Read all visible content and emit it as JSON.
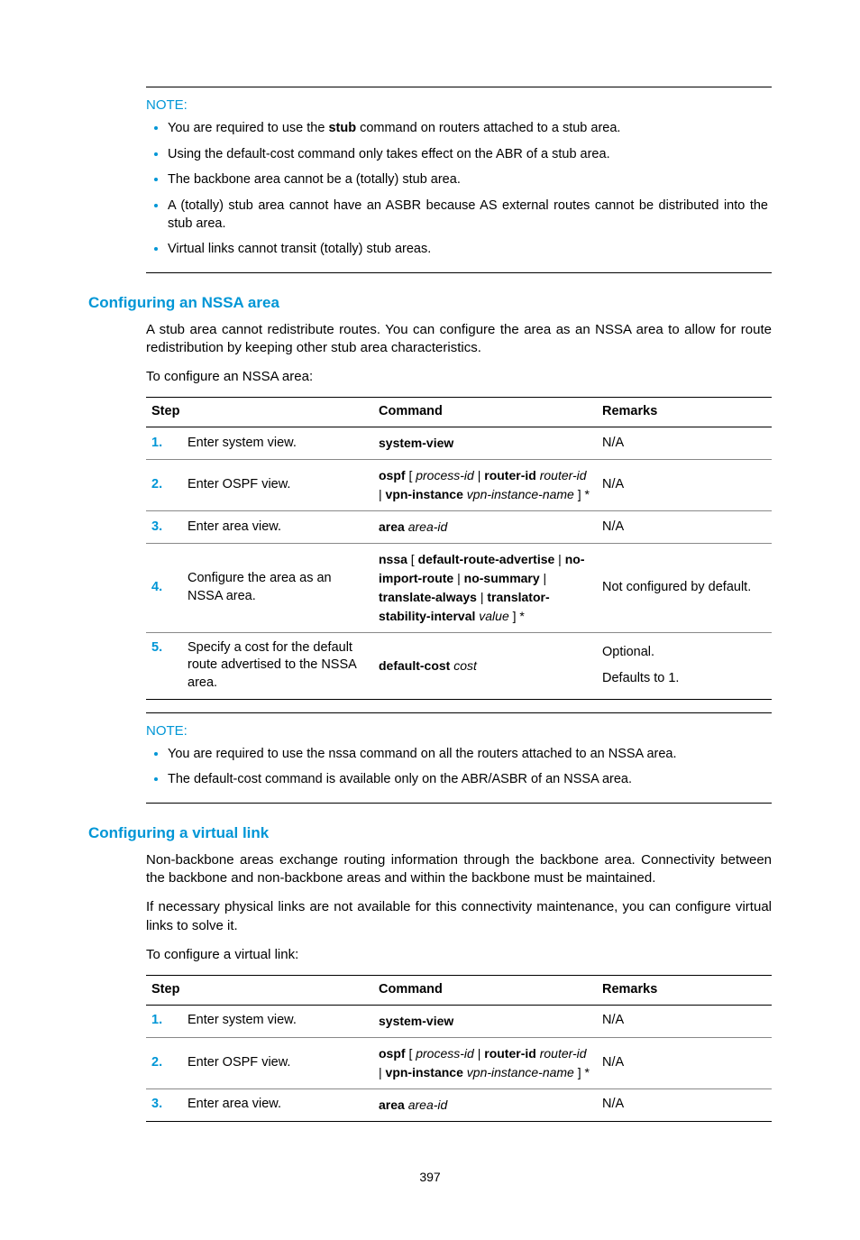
{
  "note1": {
    "label": "NOTE:",
    "items": [
      "You are required to use the <b>stub</b> command on routers attached to a stub area.",
      "Using the default-cost command only takes effect on the ABR of a stub area.",
      "The backbone area cannot be a (totally) stub area.",
      "A (totally) stub area cannot have an ASBR because AS external routes cannot be distributed into the stub area.",
      "Virtual links cannot transit (totally) stub areas."
    ]
  },
  "section_nssa": {
    "heading": "Configuring an NSSA area",
    "para1": "A stub area cannot redistribute routes. You can configure the area as an NSSA area to allow for route redistribution by keeping other stub area characteristics.",
    "para2": "To configure an NSSA area:"
  },
  "table1": {
    "headers": {
      "step": "Step",
      "command": "Command",
      "remarks": "Remarks"
    },
    "rows": [
      {
        "num": "1.",
        "desc": "Enter system view.",
        "cmd": "<b>system-view</b>",
        "remarks": "N/A"
      },
      {
        "num": "2.",
        "desc": "Enter OSPF view.",
        "cmd": "<b>ospf</b> [ <i>process-id</i> | <b>router-id</b> <i>router-id</i> | <b>vpn-instance</b> <i>vpn-instance-name</i> ] *",
        "remarks": "N/A"
      },
      {
        "num": "3.",
        "desc": "Enter area view.",
        "cmd": "<b>area</b> <i>area-id</i>",
        "remarks": "N/A"
      },
      {
        "num": "4.",
        "desc": "Configure the area as an NSSA area.",
        "cmd": "<b>nssa</b> [ <b>default-route-advertise</b> | <b>no-import-route</b> | <b>no-summary</b> | <b>translate-always</b> | <b>translator-stability-interval</b> <i>value</i> ] *",
        "remarks": "Not configured by default."
      },
      {
        "num": "5.",
        "desc": "Specify a cost for the default route advertised to the NSSA area.",
        "cmd": "<b>default-cost</b> <i>cost</i>",
        "remarks": "Optional.<br>Defaults to 1."
      }
    ]
  },
  "note2": {
    "label": "NOTE:",
    "items": [
      "You are required to use the nssa command on all the routers attached to an NSSA area.",
      "The default-cost command is available only on the ABR/ASBR of an NSSA area."
    ]
  },
  "section_vlink": {
    "heading": "Configuring a virtual link",
    "para1": "Non-backbone areas exchange routing information through the backbone area. Connectivity between the backbone and non-backbone areas and within the backbone must be maintained.",
    "para2": "If necessary physical links are not available for this connectivity maintenance, you can configure virtual links to solve it.",
    "para3": "To configure a virtual link:"
  },
  "table2": {
    "headers": {
      "step": "Step",
      "command": "Command",
      "remarks": "Remarks"
    },
    "rows": [
      {
        "num": "1.",
        "desc": "Enter system view.",
        "cmd": "<b>system-view</b>",
        "remarks": "N/A"
      },
      {
        "num": "2.",
        "desc": "Enter OSPF view.",
        "cmd": "<b>ospf</b> [ <i>process-id</i> | <b>router-id</b> <i>router-id</i> | <b>vpn-instance</b> <i>vpn-instance-name</i> ] *",
        "remarks": "N/A"
      },
      {
        "num": "3.",
        "desc": "Enter area view.",
        "cmd": "<b>area</b> <i>area-id</i>",
        "remarks": "N/A"
      }
    ]
  },
  "pagenum": "397"
}
